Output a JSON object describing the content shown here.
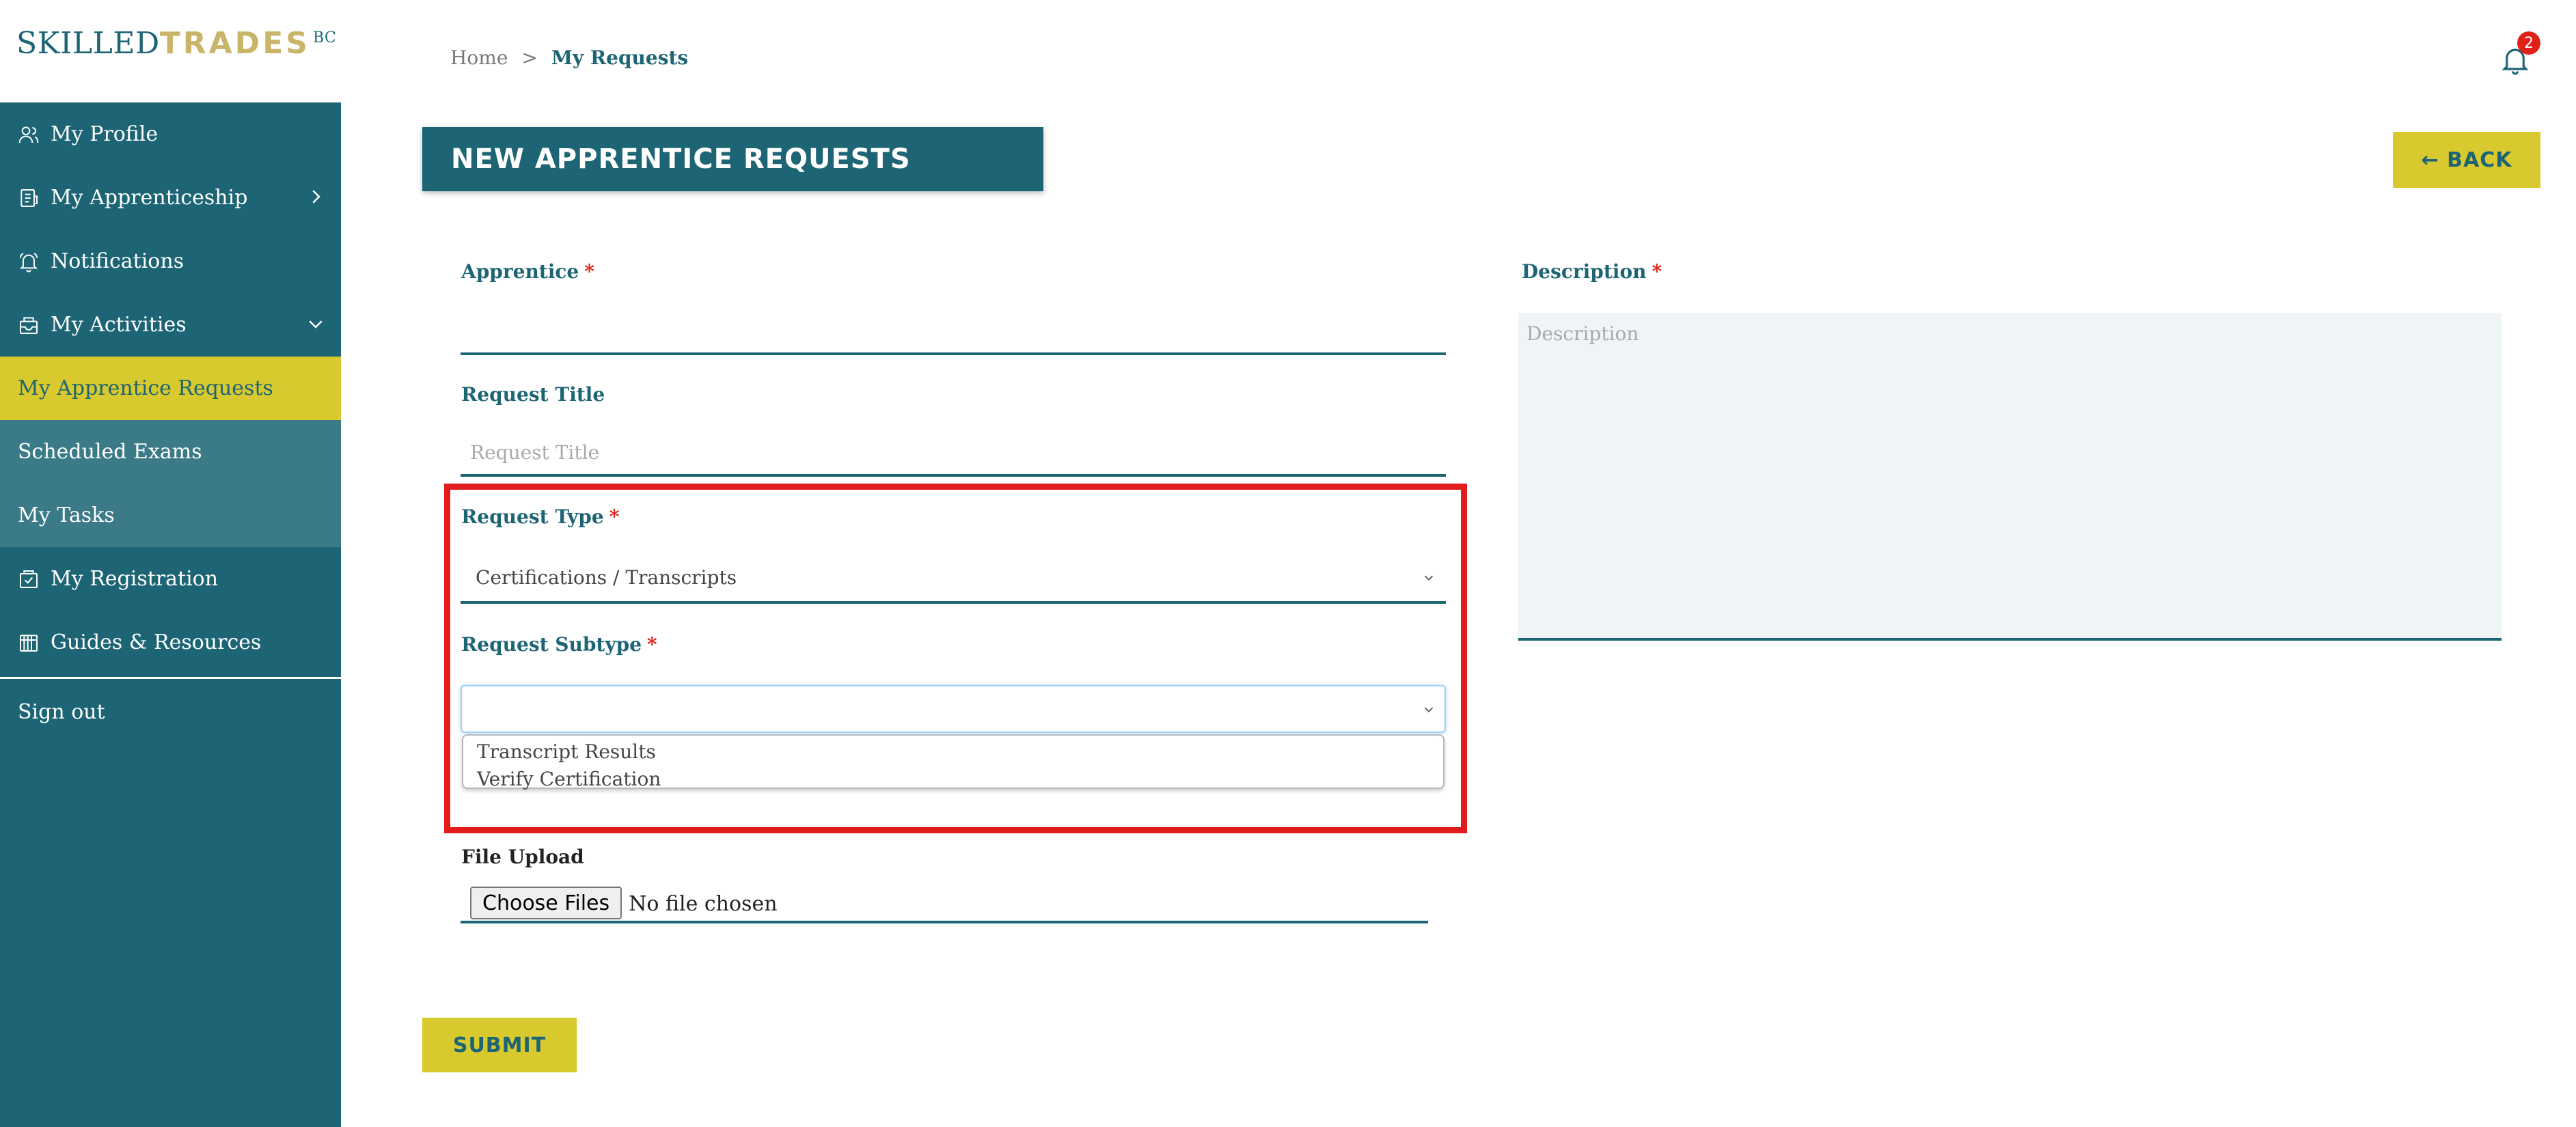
{
  "brand": {
    "name_part1": "SKILLED",
    "name_part2": "TRADES",
    "suffix": "BC"
  },
  "sidebar": {
    "items": [
      {
        "label": "My Profile",
        "icon": "person-icon"
      },
      {
        "label": "My Apprenticeship",
        "icon": "clipboard-icon",
        "chevron": "chevron-right-icon"
      },
      {
        "label": "Notifications",
        "icon": "bell-icon"
      },
      {
        "label": "My Activities",
        "icon": "inbox-icon",
        "chevron": "chevron-down-icon"
      },
      {
        "label": "My Apprentice Requests",
        "active": true
      },
      {
        "label": "Scheduled Exams"
      },
      {
        "label": "My Tasks"
      },
      {
        "label": "My Registration",
        "icon": "register-icon"
      },
      {
        "label": "Guides & Resources",
        "icon": "book-icon"
      },
      {
        "label": "Sign out"
      }
    ]
  },
  "breadcrumb": {
    "home": "Home",
    "separator": ">",
    "current": "My Requests"
  },
  "notifications": {
    "count": "2"
  },
  "page": {
    "title": "NEW APPRENTICE REQUESTS",
    "back_label": "← BACK"
  },
  "form": {
    "required_marker": "*",
    "apprentice": {
      "label": "Apprentice",
      "value": ""
    },
    "request_title": {
      "label": "Request Title",
      "placeholder": "Request Title"
    },
    "request_type": {
      "label": "Request Type",
      "value": "Certifications / Transcripts"
    },
    "request_subtype": {
      "label": "Request Subtype",
      "value": "",
      "options": [
        "Transcript Results",
        "Verify Certification"
      ]
    },
    "description": {
      "label": "Description",
      "placeholder": "Description"
    },
    "file_upload": {
      "label": "File Upload",
      "button": "Choose Files",
      "status": "No file chosen"
    },
    "submit_label": "SUBMIT"
  },
  "colors": {
    "primary": "#1d6575",
    "accent": "#d7c92e",
    "highlight": "#e21c1c",
    "badge": "#e0211a"
  }
}
